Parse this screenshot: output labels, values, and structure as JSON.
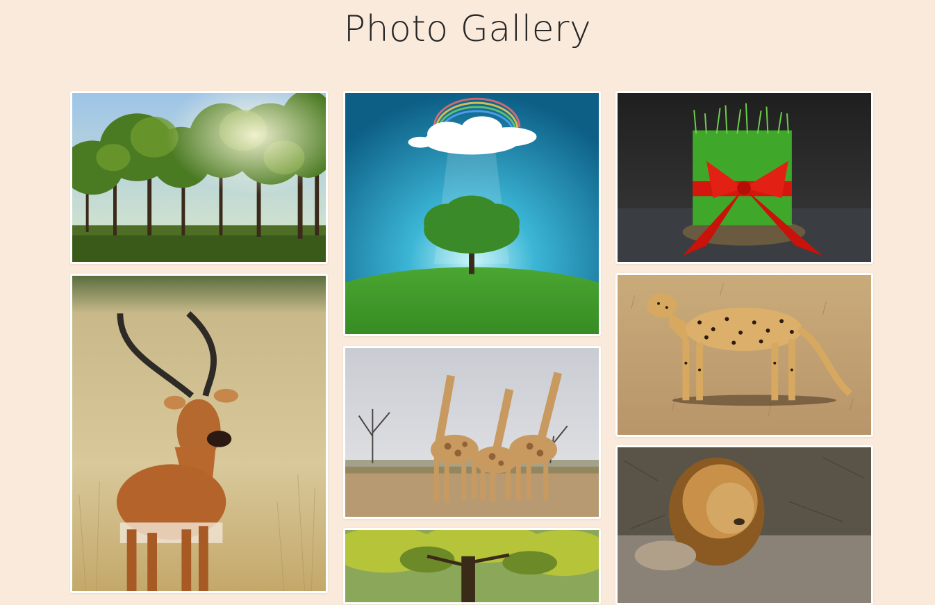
{
  "page": {
    "title": "Photo Gallery"
  },
  "colors": {
    "background": "#faeadb",
    "tile_border": "#ffffff",
    "title_text": "#262626"
  },
  "gallery": {
    "photos": [
      {
        "subject": "forest-trees"
      },
      {
        "subject": "tree-on-globe-with-rainbow"
      },
      {
        "subject": "wheatgrass-with-red-ribbon"
      },
      {
        "subject": "impala-antelope"
      },
      {
        "subject": "three-giraffes"
      },
      {
        "subject": "cheetah"
      },
      {
        "subject": "tree-canopy"
      },
      {
        "subject": "lion-resting"
      }
    ]
  }
}
